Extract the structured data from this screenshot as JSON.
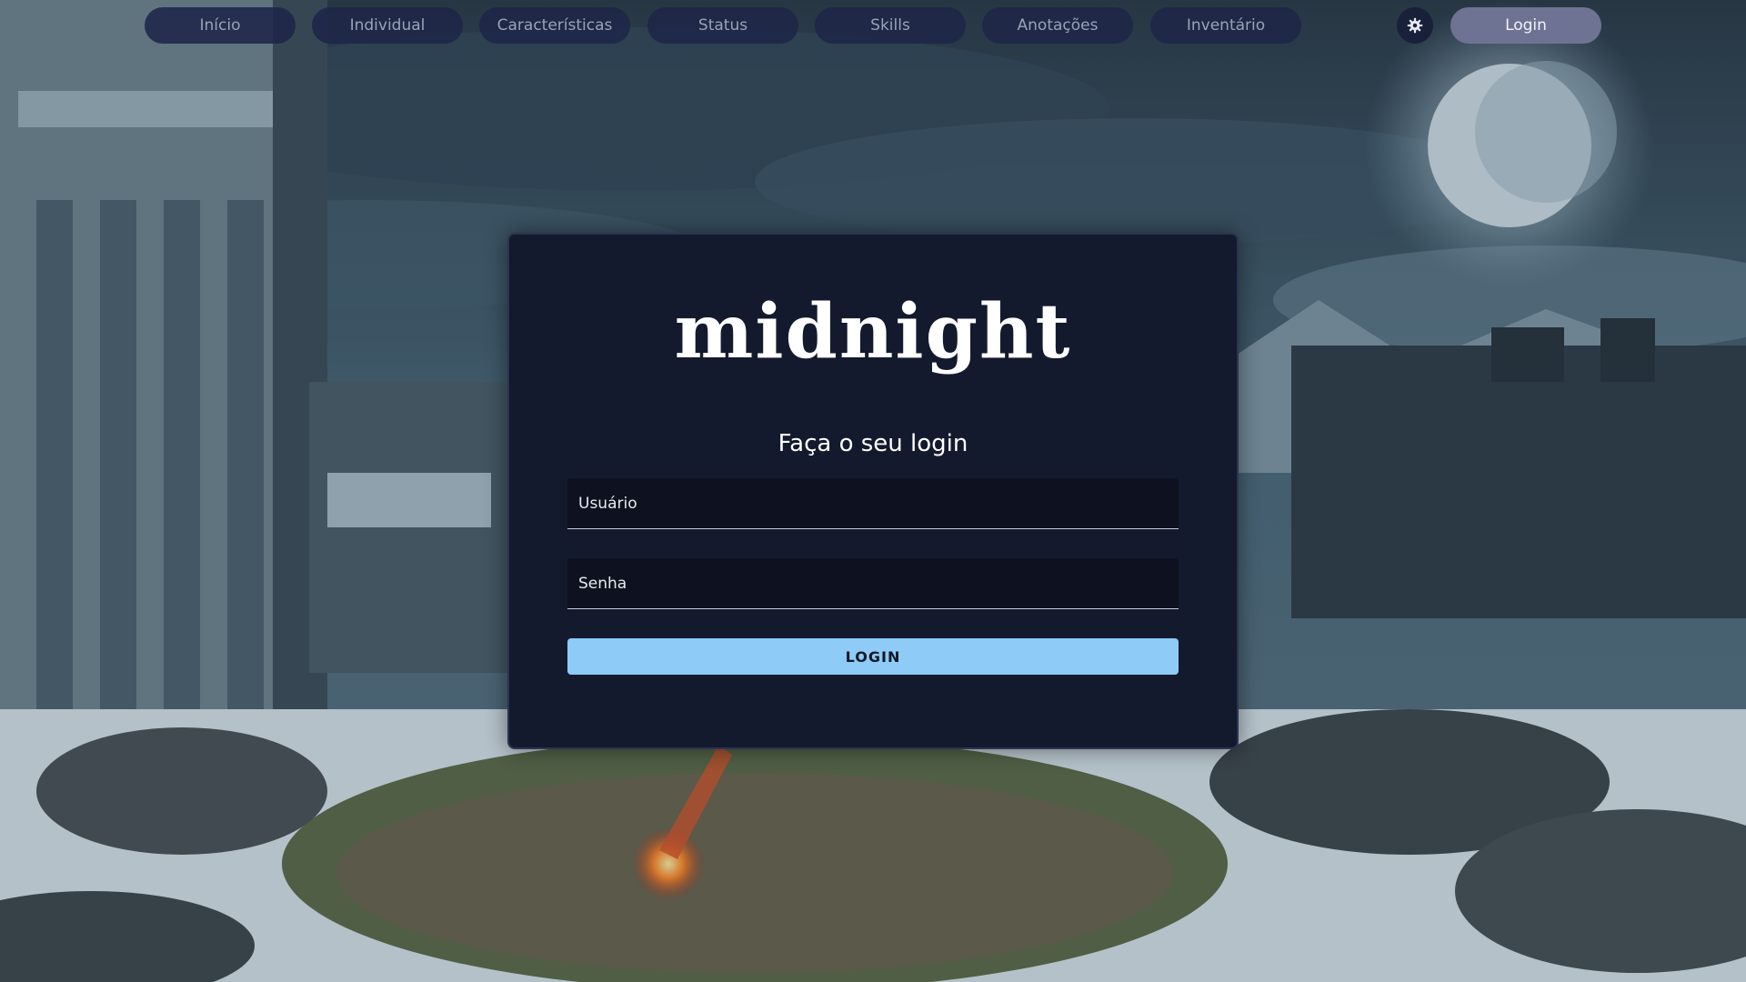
{
  "nav": {
    "items": [
      {
        "label": "Início"
      },
      {
        "label": "Individual"
      },
      {
        "label": "Características"
      },
      {
        "label": "Status"
      },
      {
        "label": "Skills"
      },
      {
        "label": "Anotações"
      },
      {
        "label": "Inventário"
      }
    ],
    "settings_icon": "gear-icon",
    "login_label": "Login"
  },
  "card": {
    "logo_text": "midnight",
    "title": "Faça o seu login",
    "username_placeholder": "Usuário",
    "password_placeholder": "Senha",
    "submit_label": "LOGIN"
  },
  "colors": {
    "nav_pill_bg": "#1e2648",
    "nav_login_bg": "#6e7394",
    "card_bg": "#141a2e",
    "input_bg": "#0e1220",
    "accent_button": "#8ecbf6"
  }
}
